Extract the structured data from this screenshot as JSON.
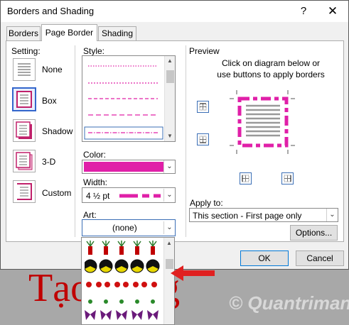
{
  "dialog": {
    "title": "Borders and Shading",
    "help": "?",
    "close": "✕"
  },
  "tabs": [
    {
      "label": "Borders",
      "active": false
    },
    {
      "label": "Page Border",
      "active": true
    },
    {
      "label": "Shading",
      "active": false
    }
  ],
  "setting": {
    "label": "Setting:",
    "options": [
      {
        "label": "None",
        "selected": false
      },
      {
        "label": "Box",
        "selected": true
      },
      {
        "label": "Shadow",
        "selected": false
      },
      {
        "label": "3-D",
        "selected": false
      },
      {
        "label": "Custom",
        "selected": false
      }
    ]
  },
  "style": {
    "label": "Style:"
  },
  "color": {
    "label": "Color:",
    "value": "#e020a8"
  },
  "width": {
    "label": "Width:",
    "value": "4 ½ pt"
  },
  "art": {
    "label": "Art:",
    "value": "(none)"
  },
  "preview": {
    "label": "Preview",
    "hint": "Click on diagram below or use buttons to apply borders"
  },
  "apply_to": {
    "label": "Apply to:",
    "value": "This section - First page only"
  },
  "buttons": {
    "options": "Options...",
    "ok": "OK",
    "cancel": "Cancel"
  },
  "background": {
    "doc_text": "Tạo hung",
    "watermark": "© Quantrimang"
  },
  "colors": {
    "accent": "#e020a8",
    "doc_text": "#c00000",
    "arrow": "#e02020"
  }
}
